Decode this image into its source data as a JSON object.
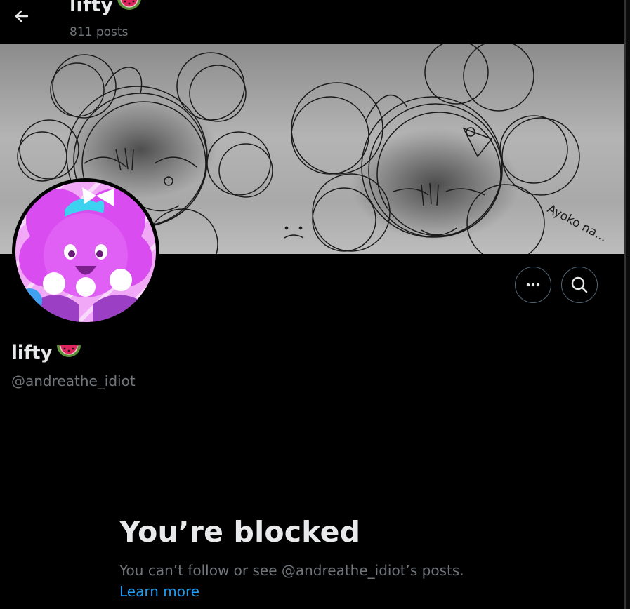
{
  "header": {
    "name": "lifty",
    "post_count": "811 posts"
  },
  "banner": {
    "signature_text": "Ayoko na..."
  },
  "actions": {
    "more_icon": "more-horizontal-icon",
    "search_icon": "search-icon"
  },
  "profile": {
    "name": "lifty",
    "handle": "@andreathe_idiot"
  },
  "blocked": {
    "title": "You’re blocked",
    "message": "You can’t follow or see @andreathe_idiot’s posts.",
    "learn_more": "Learn more"
  },
  "colors": {
    "background": "#000000",
    "primary_text": "#e7e9ea",
    "secondary_text": "#71767b",
    "link": "#1d9bf0",
    "button_border": "#536471",
    "avatar_accent": "#d94cf0"
  }
}
